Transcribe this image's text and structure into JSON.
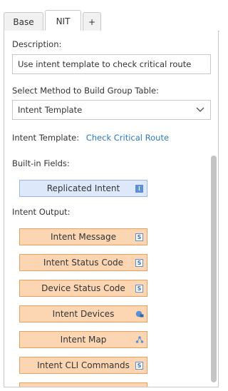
{
  "tabs": [
    {
      "label": "Base",
      "active": false
    },
    {
      "label": "NIT",
      "active": true
    },
    {
      "label": "+",
      "active": false
    }
  ],
  "description": {
    "label": "Description:",
    "value": "Use intent template to check critical route"
  },
  "method": {
    "label": "Select Method to Build Group Table:",
    "selected": "Intent Template"
  },
  "intent_template": {
    "label": "Intent Template:",
    "link": "Check Critical Route"
  },
  "builtin": {
    "label": "Built-in Fields:",
    "fields": [
      {
        "label": "Replicated Intent",
        "icon": "info-icon"
      }
    ]
  },
  "output": {
    "label": "Intent Output:",
    "fields": [
      {
        "label": "Intent Message",
        "icon": "string-type-icon"
      },
      {
        "label": "Intent Status Code",
        "icon": "string-type-icon"
      },
      {
        "label": "Device Status Code",
        "icon": "string-type-icon"
      },
      {
        "label": "Intent Devices",
        "icon": "device-type-icon"
      },
      {
        "label": "Intent Map",
        "icon": "map-type-icon"
      },
      {
        "label": "Intent CLI Commands",
        "icon": "string-type-icon"
      }
    ]
  },
  "colors": {
    "output_field_bg": "#fcd6b2",
    "output_field_border": "#e6a060",
    "builtin_field_bg": "#dde8fa",
    "link": "#2b7bb9",
    "icon_blue": "#5b8fd6"
  }
}
